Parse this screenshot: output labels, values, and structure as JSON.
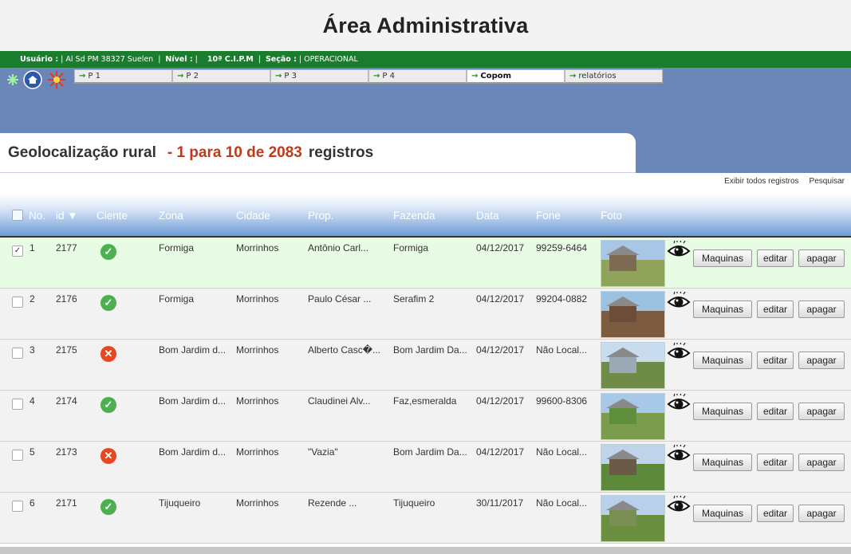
{
  "header": {
    "title": "Área Administrativa"
  },
  "userbar": {
    "usuario_label": "Usuário :",
    "usuario_value": "| Al Sd PM 38327 Suelen",
    "nivel_label": "Nível :",
    "nivel_value": "|",
    "cipm": "10ª C.I.P.M",
    "secao_label": "Seção :",
    "secao_value": "| OPERACIONAL"
  },
  "tabs": [
    {
      "arrow": "→",
      "label": "P 1"
    },
    {
      "arrow": "→",
      "label": "P 2"
    },
    {
      "arrow": "→",
      "label": "P 3"
    },
    {
      "arrow": "→",
      "label": "P 4"
    },
    {
      "arrow": "→",
      "label": "Copom"
    },
    {
      "arrow": "→",
      "label": "relatórios"
    }
  ],
  "section": {
    "title": "Geolocalização rural",
    "range": "- 1 para 10 de 2083",
    "suffix": "registros"
  },
  "links": {
    "show_all": "Exibir todos registros",
    "search": "Pesquisar"
  },
  "table": {
    "headers": {
      "no": "No.",
      "id": "id ▼",
      "ciente": "Ciente",
      "zona": "Zona",
      "cidade": "Cidade",
      "prop": "Prop.",
      "fazenda": "Fazenda",
      "data": "Data",
      "fone": "Fone",
      "foto": "Foto"
    },
    "buttons": {
      "maquinas": "Maquinas",
      "editar": "editar",
      "apagar": "apagar"
    },
    "rows": [
      {
        "no": "1",
        "id": "2177",
        "ciente": true,
        "zona": "Formiga",
        "cidade": "Morrinhos",
        "prop": "Antônio Carl...",
        "fazenda": "Formiga",
        "data": "04/12/2017",
        "fone": "99259-6464",
        "checked": true
      },
      {
        "no": "2",
        "id": "2176",
        "ciente": true,
        "zona": "Formiga",
        "cidade": "Morrinhos",
        "prop": "Paulo César ...",
        "fazenda": "Serafim 2",
        "data": "04/12/2017",
        "fone": "99204-0882",
        "checked": false
      },
      {
        "no": "3",
        "id": "2175",
        "ciente": false,
        "zona": "Bom Jardim d...",
        "cidade": "Morrinhos",
        "prop": "Alberto Casc�...",
        "fazenda": "Bom Jardim Da...",
        "data": "04/12/2017",
        "fone": "Não Local...",
        "checked": false
      },
      {
        "no": "4",
        "id": "2174",
        "ciente": true,
        "zona": "Bom Jardim d...",
        "cidade": "Morrinhos",
        "prop": "Claudinei Alv...",
        "fazenda": "Faz,esmeralda",
        "data": "04/12/2017",
        "fone": "99600-8306",
        "checked": false
      },
      {
        "no": "5",
        "id": "2173",
        "ciente": false,
        "zona": "Bom Jardim d...",
        "cidade": "Morrinhos",
        "prop": "\"Vazia\"",
        "fazenda": "Bom Jardim Da...",
        "data": "04/12/2017",
        "fone": "Não Local...",
        "checked": false
      },
      {
        "no": "6",
        "id": "2171",
        "ciente": true,
        "zona": "Tijuqueiro",
        "cidade": "Morrinhos",
        "prop": "Rezende ...",
        "fazenda": "Tijuqueiro",
        "data": "30/11/2017",
        "fone": "Não Local...",
        "checked": false
      }
    ]
  },
  "colors": {
    "green_bar": "#1a7c2d",
    "blue_area": "#6b86b8",
    "accent_red": "#c0391b",
    "ok": "#4caf50",
    "no": "#e8481f"
  }
}
